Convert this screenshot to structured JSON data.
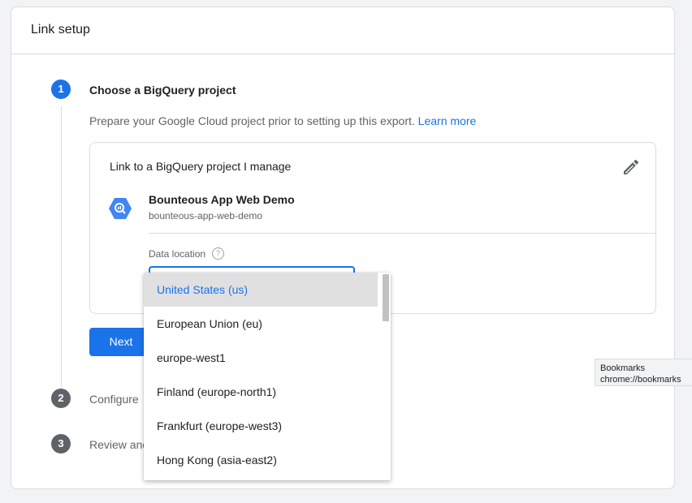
{
  "header": {
    "title": "Link setup"
  },
  "steps": [
    {
      "number": "1",
      "title": "Choose a BigQuery project"
    },
    {
      "number": "2",
      "title": "Configure"
    },
    {
      "number": "3",
      "title": "Review and"
    }
  ],
  "step1": {
    "description": "Prepare your Google Cloud project prior to setting up this export.",
    "learn_more": "Learn more",
    "box_heading": "Link to a BigQuery project I manage",
    "project_name": "Bounteous App Web Demo",
    "project_id": "bounteous-app-web-demo",
    "data_location_label": "Data location",
    "help_glyph": "?",
    "next_label": "Next"
  },
  "dropdown": {
    "options": [
      "United States (us)",
      "European Union (eu)",
      "europe-west1",
      "Finland (europe-north1)",
      "Frankfurt (europe-west3)",
      "Hong Kong (asia-east2)"
    ],
    "selected": "United States (us)"
  },
  "tooltip": {
    "title": "Bookmarks",
    "url": "chrome://bookmarks"
  },
  "colors": {
    "accent": "#1a73e8",
    "step_inactive": "#5f6368",
    "bigquery_icon": "#4285f4"
  },
  "icons": {
    "edit": "pencil-icon",
    "project": "bigquery-icon",
    "help": "help-icon"
  }
}
